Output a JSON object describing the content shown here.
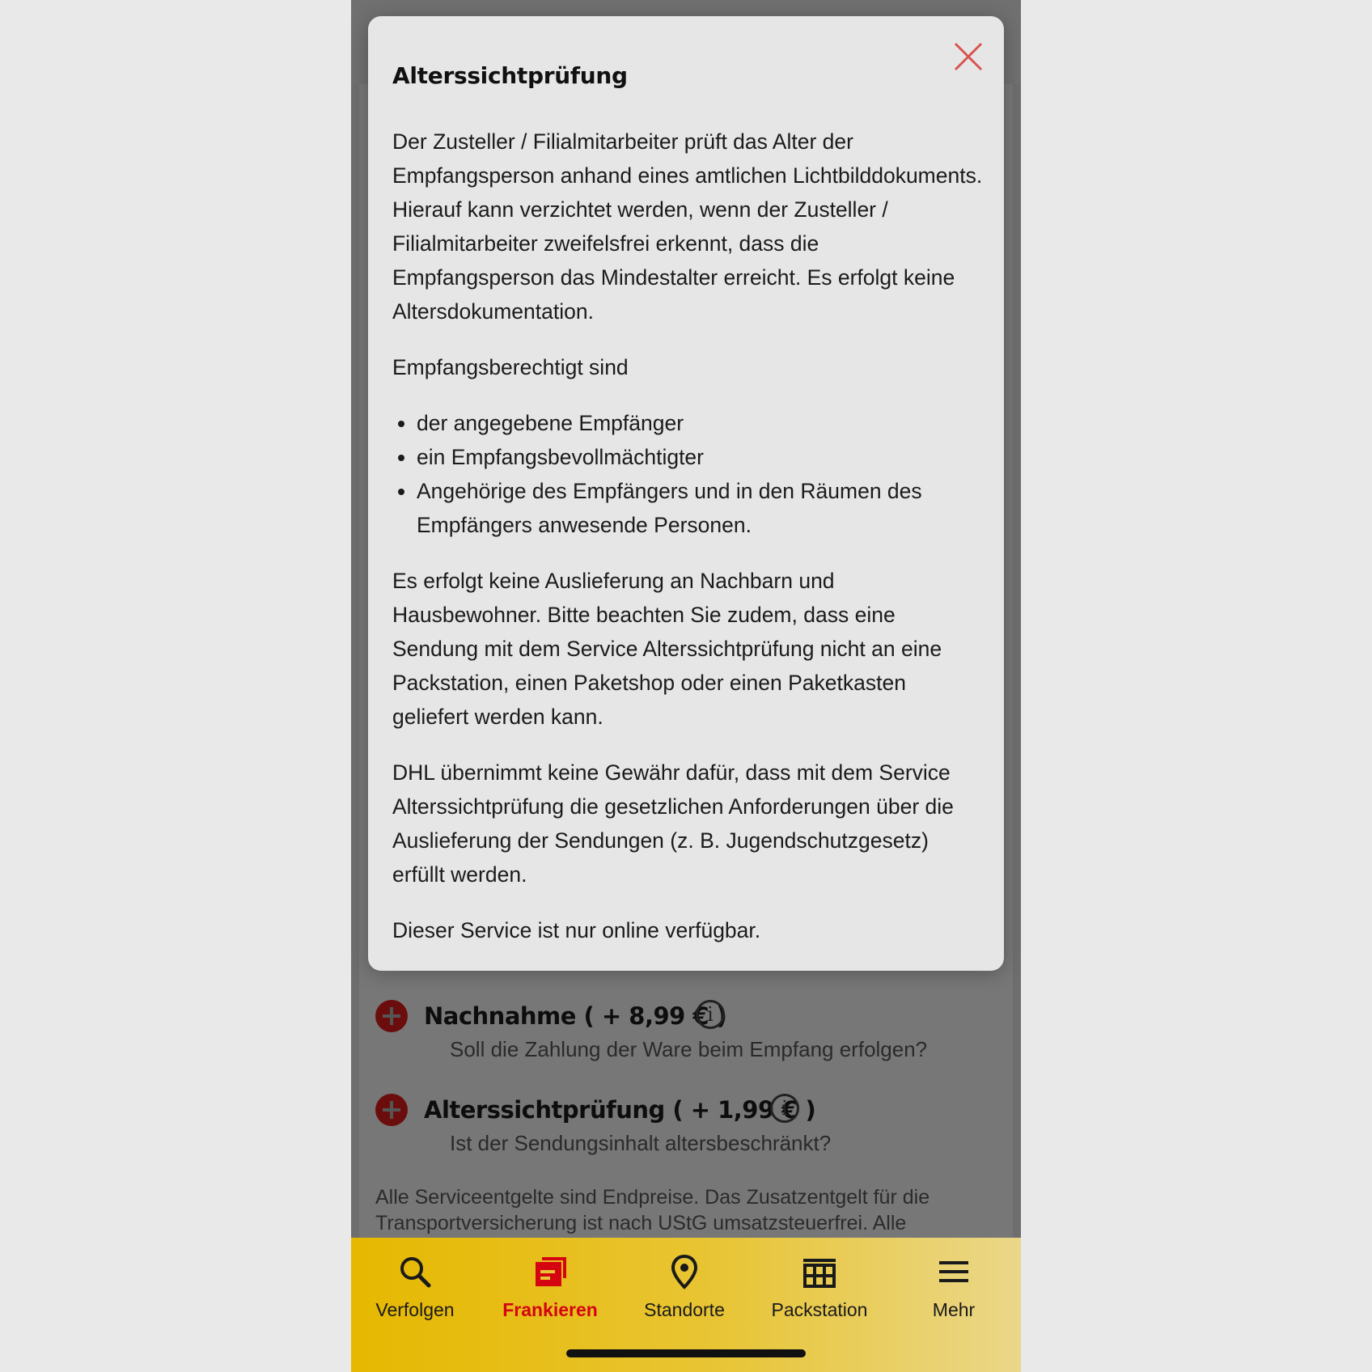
{
  "modal": {
    "title": "Alterssichtprüfung",
    "close_icon": "close-icon",
    "close_color": "#d9534f",
    "paragraph1": "Der Zusteller / Filialmitarbeiter prüft das Alter der Empfangsperson anhand eines amtlichen Lichtbilddokuments. Hierauf kann verzichtet werden, wenn der Zusteller / Filialmitarbeiter zweifelsfrei erkennt, dass die Empfangsperson das Mindestalter erreicht. Es erfolgt keine Altersdokumentation.",
    "paragraph2": "Empfangsberechtigt sind",
    "bullets": [
      "der angegebene Empfänger",
      "ein Empfangsbevollmächtigter",
      "Angehörige des Empfängers und in den Räumen des Empfängers anwesende Personen."
    ],
    "paragraph3": "Es erfolgt keine Auslieferung an Nachbarn und Hausbewohner. Bitte beachten Sie zudem, dass eine Sendung mit dem Service Alterssichtprüfung nicht an eine Packstation, einen Paketshop oder einen Paketkasten geliefert werden kann.",
    "paragraph4": "DHL übernimmt keine Gewähr dafür, dass mit dem Service Alterssichtprüfung die gesetzlichen Anforderungen über die Auslieferung der Sendungen (z. B. Jugendschutzgesetz) erfüllt werden.",
    "paragraph5": "Dieser Service ist nur online verfügbar."
  },
  "services": [
    {
      "title": "Nachnahme ( + 8,99 € )",
      "description": "Soll die Zahlung der Ware beim Empfang erfolgen?",
      "icon": "plus-circle-icon"
    },
    {
      "title": "Alterssichtprüfung ( + 1,99 € )",
      "description": "Ist der Sendungsinhalt altersbeschränkt?",
      "icon": "plus-circle-icon"
    }
  ],
  "footnote": "Alle Serviceentgelte sind Endpreise. Das Zusatzentgelt für die Transportversicherung ist nach UStG umsatzsteuerfrei. Alle",
  "tabbar": {
    "active": "Frankieren",
    "accent_color": "#d40511",
    "brand_color": "#ffcc00",
    "items": [
      {
        "label": "Verfolgen",
        "icon": "search-icon"
      },
      {
        "label": "Frankieren",
        "icon": "stamp-icon"
      },
      {
        "label": "Standorte",
        "icon": "location-pin-icon"
      },
      {
        "label": "Packstation",
        "icon": "packstation-icon"
      },
      {
        "label": "Mehr",
        "icon": "menu-icon"
      }
    ]
  }
}
